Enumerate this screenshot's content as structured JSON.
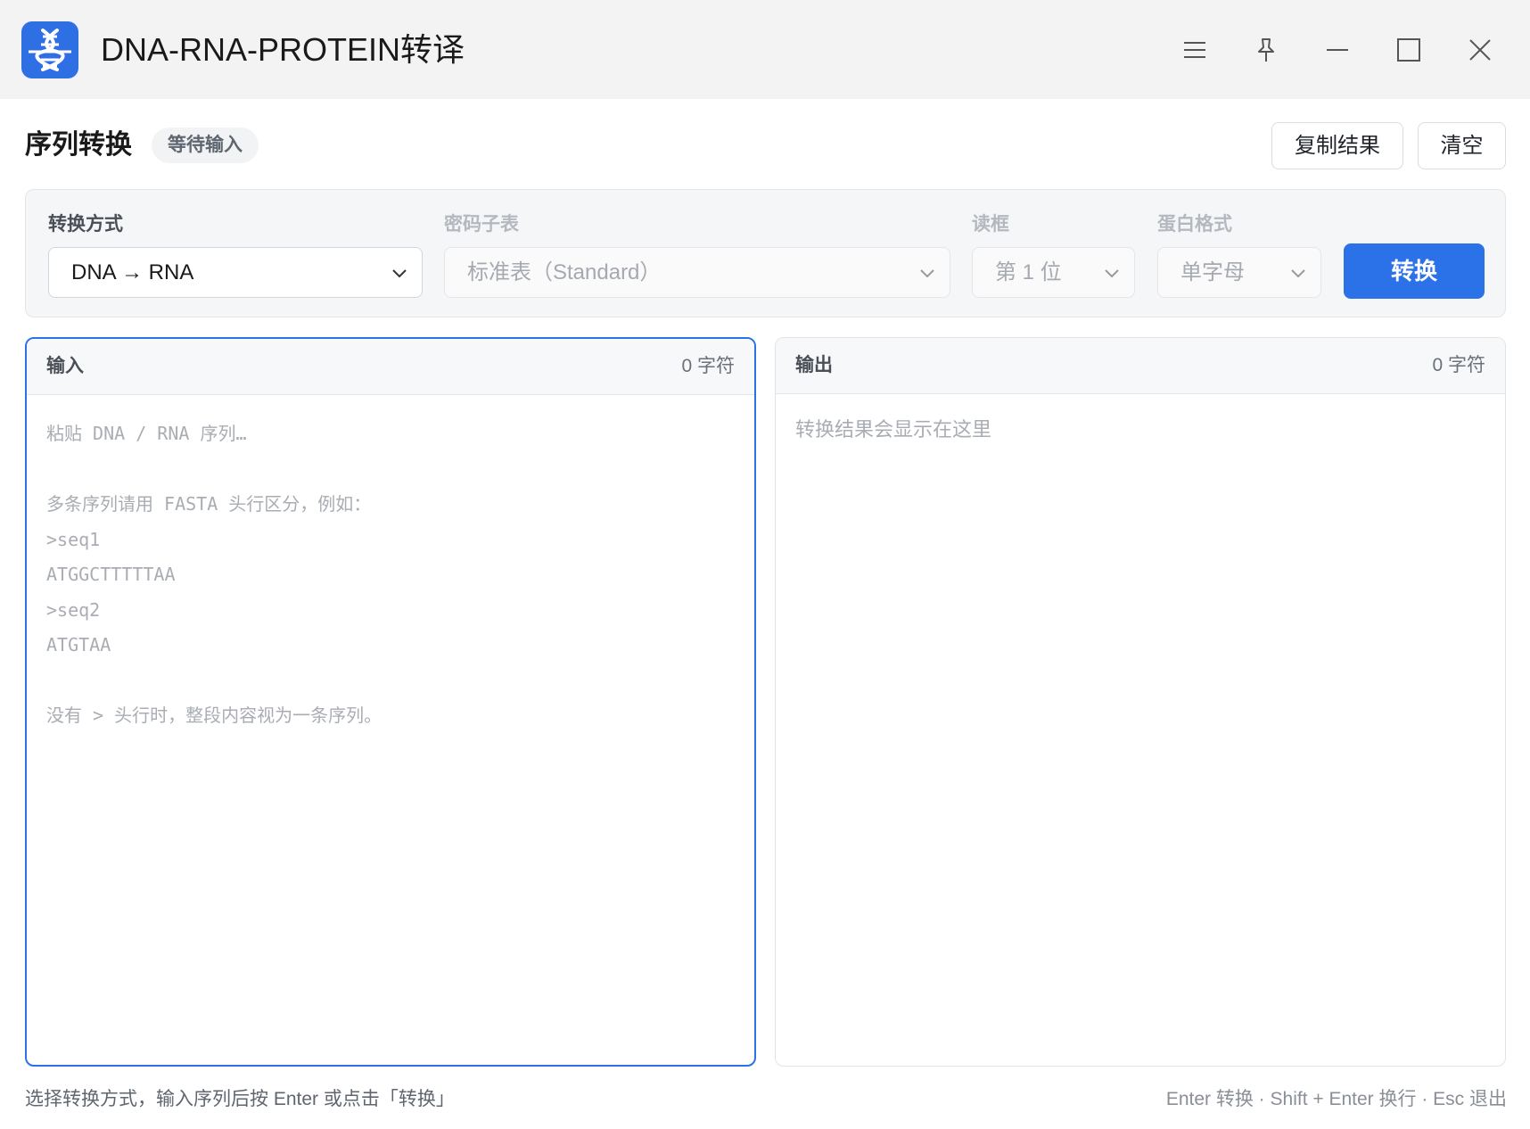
{
  "window": {
    "title": "DNA-RNA-PROTEIN转译",
    "app_icon": "dna-helix-icon",
    "controls": [
      "menu-icon",
      "pin-icon",
      "minimize-icon",
      "maximize-icon",
      "close-icon"
    ]
  },
  "header": {
    "title": "序列转换",
    "status": "等待输入",
    "copy_label": "复制结果",
    "clear_label": "清空"
  },
  "options": {
    "mode_label": "转换方式",
    "mode_value": "DNA → RNA",
    "codon_label": "密码子表",
    "codon_value": "标准表（Standard）",
    "frame_label": "读框",
    "frame_value": "第 1 位",
    "format_label": "蛋白格式",
    "format_value": "单字母",
    "convert_label": "转换"
  },
  "input": {
    "title": "输入",
    "count": "0 字符",
    "placeholder": "粘贴 DNA / RNA 序列…\n\n多条序列请用 FASTA 头行区分，例如：\n>seq1\nATGGCTTTTTAA\n>seq2\nATGTAA\n\n没有 > 头行时，整段内容视为一条序列。"
  },
  "output": {
    "title": "输出",
    "count": "0 字符",
    "placeholder": "转换结果会显示在这里"
  },
  "footer": {
    "hint": "选择转换方式，输入序列后按 Enter 或点击「转换」",
    "shortcuts": "Enter 转换 · Shift + Enter 换行 · Esc 退出"
  },
  "colors": {
    "accent": "#2b72e8",
    "titlebar_bg": "#f3f3f3",
    "panel_bg": "#f5f6f8"
  }
}
